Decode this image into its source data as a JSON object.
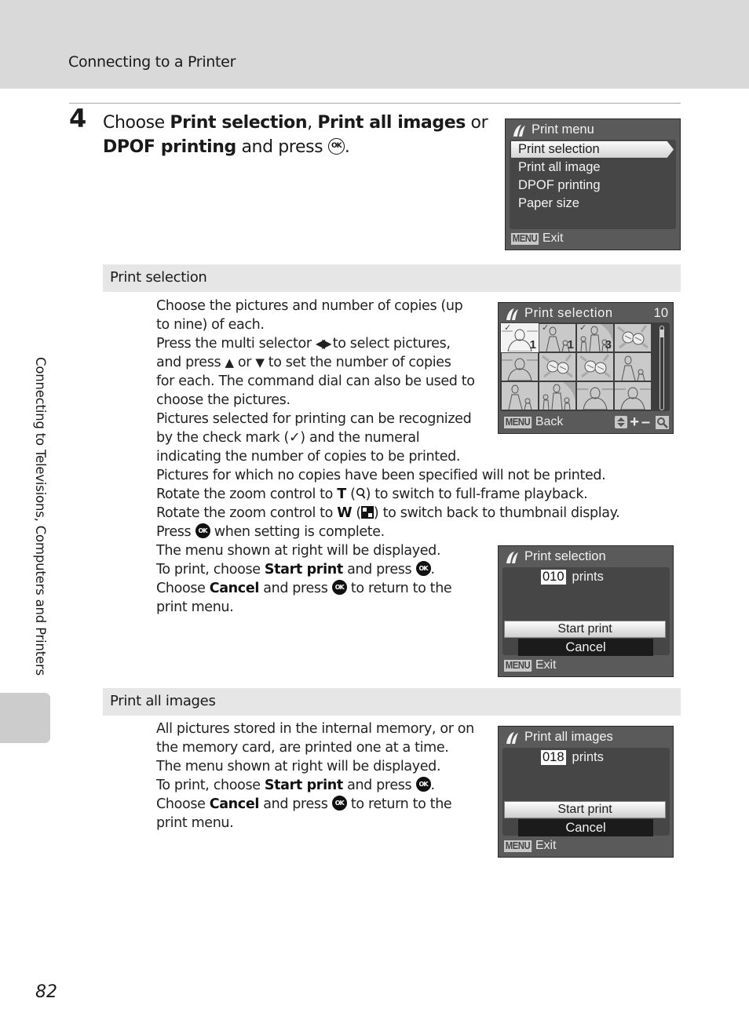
{
  "header": {
    "title": "Connecting to a Printer"
  },
  "side_tab": {
    "label": "Connecting to Televisions, Computers and Printers"
  },
  "page_number": "82",
  "step": {
    "number": "4",
    "text_parts": [
      "Choose ",
      "Print selection",
      ", ",
      "Print all images",
      " or",
      "DPOF printing",
      " and press ",
      "."
    ],
    "ok_label": "OK"
  },
  "print_menu_screen": {
    "title": "Print menu",
    "items": [
      "Print selection",
      "Print all image",
      "DPOF printing",
      "Paper size"
    ],
    "selected_index": 0,
    "footer_key": "MENU",
    "footer_label": "Exit"
  },
  "section_print_selection": {
    "title": "Print selection",
    "lines": [
      "Choose the pictures and number of copies (up",
      "to nine) of each.",
      [
        "Press the multi selector ",
        "◀▶",
        " to select pictures,"
      ],
      [
        "and press ",
        "▲",
        " or ",
        "▼",
        " to set the number of copies"
      ],
      "for each. The command dial can also be used to",
      "choose the pictures.",
      "Pictures selected for printing can be recognized",
      [
        "by the check mark (",
        "✓",
        ") and the numeral"
      ],
      "indicating the number of copies to be printed.",
      "Pictures for which no copies have been specified will not be printed.",
      [
        "Rotate the zoom control to ",
        "T",
        " (",
        "🔍",
        ") to switch to full-frame playback."
      ],
      [
        "Rotate the zoom control to ",
        "W",
        " (",
        "▦",
        ") to switch back to thumbnail display."
      ],
      [
        "Press ",
        "OK",
        " when setting is complete."
      ],
      "The menu shown at right will be displayed.",
      [
        "To print, choose ",
        "Start print",
        " and press ",
        "OK",
        "."
      ],
      [
        "Choose ",
        "Cancel",
        " and press ",
        "OK",
        " to return to the"
      ],
      "print menu."
    ],
    "selection_screen": {
      "title": "Print selection",
      "count": "10",
      "thumbnails": [
        {
          "checked": true,
          "copies": "1",
          "active": true,
          "subject": "woman-portrait"
        },
        {
          "checked": true,
          "copies": "1",
          "active": false,
          "subject": "woman-child"
        },
        {
          "checked": true,
          "copies": "3",
          "active": false,
          "subject": "family"
        },
        {
          "checked": false,
          "copies": "",
          "active": false,
          "subject": "flowers"
        },
        {
          "checked": false,
          "copies": "",
          "active": false,
          "subject": "woman-portrait"
        },
        {
          "checked": false,
          "copies": "",
          "active": false,
          "subject": "flowers"
        },
        {
          "checked": false,
          "copies": "",
          "active": false,
          "subject": "flowers"
        },
        {
          "checked": false,
          "copies": "",
          "active": false,
          "subject": "woman-child"
        },
        {
          "checked": false,
          "copies": "",
          "active": false,
          "subject": "woman-child"
        },
        {
          "checked": false,
          "copies": "",
          "active": false,
          "subject": "family"
        },
        {
          "checked": false,
          "copies": "",
          "active": false,
          "subject": "woman-portrait"
        },
        {
          "checked": false,
          "copies": "",
          "active": false,
          "subject": "woman-portrait"
        }
      ],
      "footer_key": "MENU",
      "footer_label": "Back",
      "footer_icons": [
        "up-down-icon",
        "plus-icon",
        "minus-icon",
        "zoom-icon"
      ]
    },
    "confirm_screen": {
      "title": "Print selection",
      "count": "010",
      "count_unit": "prints",
      "start_label": "Start print",
      "cancel_label": "Cancel",
      "footer_key": "MENU",
      "footer_label": "Exit"
    }
  },
  "section_print_all": {
    "title": "Print all images",
    "lines": [
      "All pictures stored in the internal memory, or on",
      "the memory card, are printed one at a time.",
      "The menu shown at right will be displayed.",
      [
        "To print, choose ",
        "Start print",
        " and press ",
        "OK",
        "."
      ],
      [
        "Choose ",
        "Cancel",
        " and press ",
        "OK",
        " to return to the"
      ],
      "print menu."
    ],
    "confirm_screen": {
      "title": "Print all images",
      "count": "018",
      "count_unit": "prints",
      "start_label": "Start print",
      "cancel_label": "Cancel",
      "footer_key": "MENU",
      "footer_label": "Exit"
    }
  }
}
